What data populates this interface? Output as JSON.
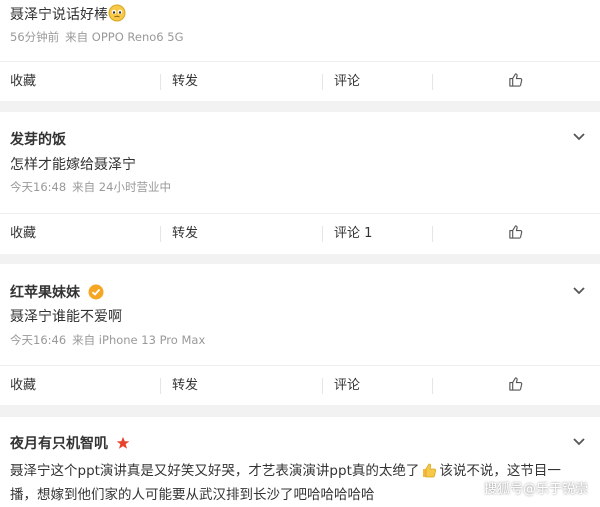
{
  "comments": [
    {
      "text": "聂泽宁说话好棒",
      "meta_time": "56分钟前",
      "meta_source": "来自 OPPO Reno6 5G",
      "actions": {
        "collect": "收藏",
        "forward": "转发",
        "comment": "评论"
      }
    },
    {
      "name": "发芽的饭",
      "text": "怎样才能嫁给聂泽宁",
      "meta_time": "今天16:48",
      "meta_source": "来自 24小时营业中",
      "actions": {
        "collect": "收藏",
        "forward": "转发",
        "comment": "评论 1"
      }
    },
    {
      "name": "红苹果妹妹",
      "text": "聂泽宁谁能不爱啊",
      "meta_time": "今天16:46",
      "meta_source": "来自 iPhone 13 Pro Max",
      "actions": {
        "collect": "收藏",
        "forward": "转发",
        "comment": "评论"
      }
    },
    {
      "name": "夜月有只机智叽",
      "text_line1_a": "聂泽宁这个ppt演讲真是又好笑又好哭，才艺表演演讲ppt真的太绝了",
      "text_line1_b": "该说不说，这节目一",
      "text_line2": "播，想嫁到他们家的人可能要从武汉排到长沙了吧哈哈哈哈哈"
    }
  ],
  "watermark": "搜狐号@乐于锐崇",
  "colors": {
    "background": "#f2f2f2",
    "card": "#ffffff",
    "meta": "#999999",
    "verified": "#f5a623",
    "star": "#e8412c"
  }
}
